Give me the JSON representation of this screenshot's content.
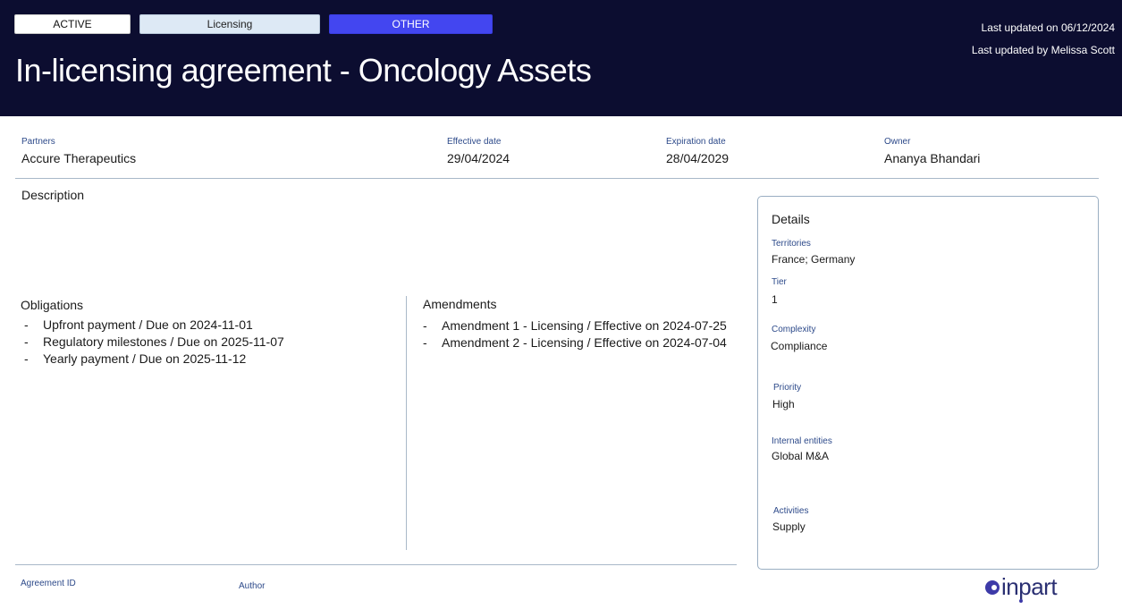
{
  "header": {
    "status_pill": "ACTIVE",
    "type_pill": "Licensing",
    "category_pill": "OTHER",
    "last_updated_on": "Last updated on 06/12/2024",
    "last_updated_by": "Last updated by Melissa Scott",
    "title": "In-licensing agreement - Oncology Assets"
  },
  "summary": {
    "partners_label": "Partners",
    "partners_value": "Accure Therapeutics",
    "effective_label": "Effective date",
    "effective_value": "29/04/2024",
    "expiration_label": "Expiration date",
    "expiration_value": "28/04/2029",
    "owner_label": "Owner",
    "owner_value": "Ananya Bhandari"
  },
  "description": {
    "title": "Description"
  },
  "obligations": {
    "title": "Obligations",
    "items": [
      {
        "dash": "-",
        "text": "Upfront payment / Due on 2024-11-01"
      },
      {
        "dash": "-",
        "text": "Regulatory milestones / Due on 2025-11-07"
      },
      {
        "dash": "-",
        "text": "Yearly payment / Due on 2025-11-12"
      }
    ]
  },
  "amendments": {
    "title": "Amendments",
    "items": [
      {
        "dash": "-",
        "text": "Amendment 1 - Licensing / Effective on 2024-07-25"
      },
      {
        "dash": "-",
        "text": "Amendment 2 - Licensing / Effective on 2024-07-04"
      }
    ]
  },
  "details": {
    "title": "Details",
    "territories_label": "Territories",
    "territories_value": "France; Germany",
    "tier_label": "Tier",
    "tier_value": "1",
    "complexity_label": "Complexity",
    "complexity_value": "Compliance",
    "priority_label": "Priority",
    "priority_value": "High",
    "internal_entities_label": "Internal entities",
    "internal_entities_value": "Global M&A",
    "activities_label": "Activities",
    "activities_value": "Supply"
  },
  "footer": {
    "agreement_id_label": "Agreement ID",
    "author_label": "Author",
    "logo_text": "inpart"
  },
  "colors": {
    "header_bg": "#0c0d30",
    "accent": "#4346f0",
    "label": "#2d4a8a"
  }
}
